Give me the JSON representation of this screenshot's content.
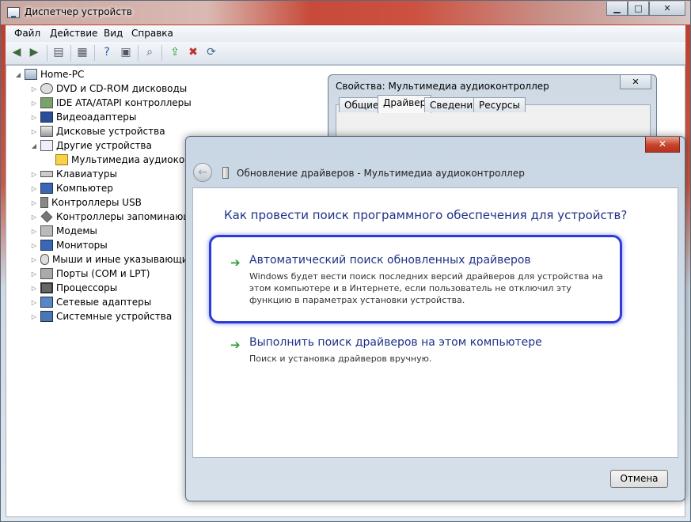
{
  "window": {
    "title": "Диспетчер устройств"
  },
  "menu": {
    "items": [
      "Файл",
      "Действие",
      "Вид",
      "Справка"
    ]
  },
  "tree": {
    "root": "Home-PC",
    "items": [
      "DVD и CD-ROM дисководы",
      "IDE ATA/ATAPI контроллеры",
      "Видеоадаптеры",
      "Дисковые устройства",
      "Другие устройства",
      "Мультимедиа аудиоконтр",
      "Клавиатуры",
      "Компьютер",
      "Контроллеры USB",
      "Контроллеры запоминающих",
      "Модемы",
      "Мониторы",
      "Мыши и иные указывающие",
      "Порты (COM и LPT)",
      "Процессоры",
      "Сетевые адаптеры",
      "Системные устройства"
    ]
  },
  "properties": {
    "title": "Свойства: Мультимедиа аудиоконтроллер",
    "tabs": [
      "Общие",
      "Драйвер",
      "Сведения",
      "Ресурсы"
    ],
    "active_tab": "Драйвер"
  },
  "wizard": {
    "title": "Обновление драйверов - Мультимедиа аудиоконтроллер",
    "heading": "Как провести поиск программного обеспечения для устройств?",
    "options": [
      {
        "title": "Автоматический поиск обновленных драйверов",
        "description": "Windows будет вести поиск последних версий драйверов для устройства на этом компьютере и в Интернете, если пользователь не отключил эту функцию в параметрах установки устройства."
      },
      {
        "title": "Выполнить поиск драйверов на этом компьютере",
        "description": "Поиск и установка драйверов вручную."
      }
    ],
    "cancel_label": "Отмена"
  },
  "colors": {
    "link_blue": "#1e3287",
    "arrow_green": "#2f9a36",
    "highlight": "#2d3bd8"
  }
}
